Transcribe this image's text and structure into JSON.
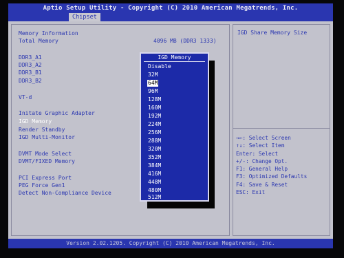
{
  "title": "Aptio Setup Utility - Copyright (C) 2010 American Megatrends, Inc.",
  "tab": "Chipset",
  "settings": {
    "memory_information": "Memory Information",
    "total_memory_label": "Total Memory",
    "total_memory_value": "4096 MB (DDR3 1333)",
    "ddr3_a1": "DDR3_A1",
    "ddr3_a2": "DDR3_A2",
    "ddr3_b1": "DDR3_B1",
    "ddr3_b2": "DDR3_B2",
    "vtd": "VT-d",
    "initiate_graphic_adapter": "Initate Graphic Adapter",
    "igd_memory": "IGD Memory",
    "render_standby": "Render Standby",
    "igd_multi_monitor": "IGD Multi-Monitor",
    "dvmt_mode_select": "DVMT Mode Select",
    "dvmt_fixed_memory": "DVMT/FIXED Memory",
    "pci_express_port": "PCI Express Port",
    "peg_force_gen1": "PEG Force Gen1",
    "detect_non_compliance": "Detect Non-Compliance Device"
  },
  "popup": {
    "title": "IGD Memory",
    "options": [
      "Disable",
      "32M",
      "64M",
      "96M",
      "128M",
      "160M",
      "192M",
      "224M",
      "256M",
      "288M",
      "320M",
      "352M",
      "384M",
      "416M",
      "448M",
      "480M",
      "512M"
    ],
    "highlighted": "64M"
  },
  "help": {
    "title": "IGD Share Memory Size",
    "keys": [
      "→←: Select Screen",
      "↑↓: Select Item",
      "Enter: Select",
      "+/-: Change Opt.",
      "F1: General Help",
      "F3: Optimized Defaults",
      "F4: Save & Reset",
      "ESC: Exit"
    ]
  },
  "footer": "Version 2.02.1205. Copyright (C) 2010 American Megatrends, Inc.",
  "colors": {
    "bios_blue": "#2a36b0",
    "panel_gray": "#c2c2cc",
    "popup_blue": "#1c2aa8",
    "highlight_white": "#ffffff"
  }
}
